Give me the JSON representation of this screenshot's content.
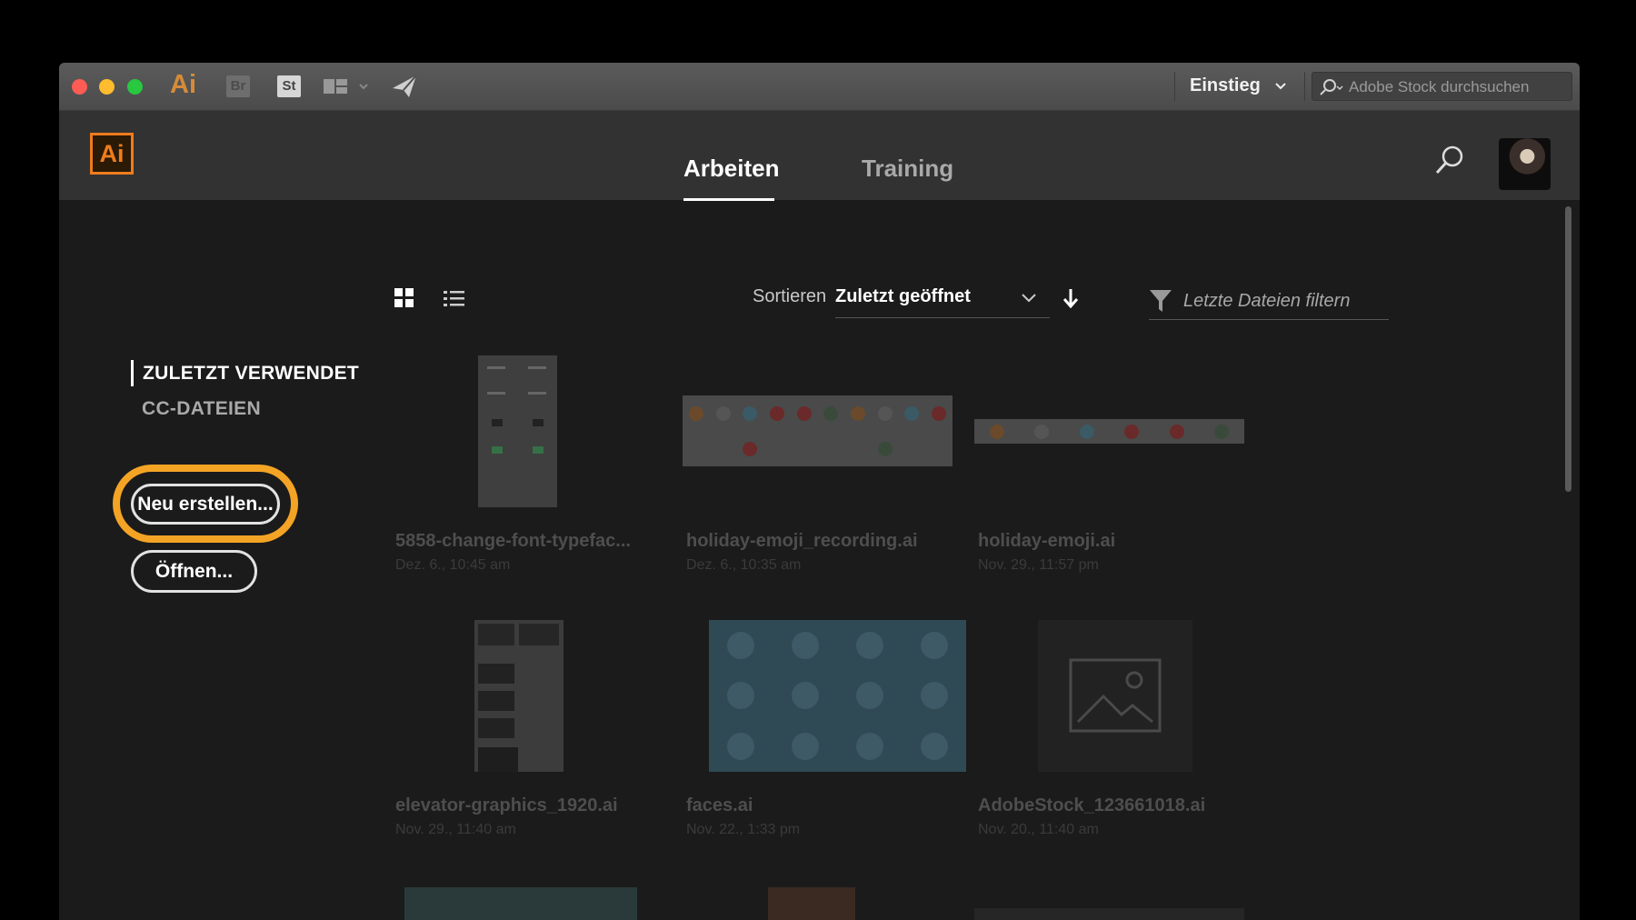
{
  "titlebar": {
    "app_glyph": "Ai",
    "bridge_label": "Br",
    "stock_label": "St",
    "workspace": "Einstieg",
    "stock_search_placeholder": "Adobe Stock durchsuchen"
  },
  "header": {
    "logo": "Ai",
    "tabs": [
      {
        "label": "Arbeiten",
        "active": true
      },
      {
        "label": "Training",
        "active": false
      }
    ]
  },
  "sidebar": {
    "nav": [
      {
        "label": "ZULETZT VERWENDET",
        "active": true
      },
      {
        "label": "CC-DATEIEN",
        "active": false
      }
    ],
    "new_button": "Neu erstellen...",
    "open_button": "Öffnen..."
  },
  "toolbar": {
    "sort_label": "Sortieren",
    "sort_value": "Zuletzt geöffnet",
    "filter_placeholder": "Letzte Dateien filtern"
  },
  "files": [
    {
      "name": "5858-change-font-typeface.ai",
      "display": "5858-change-font-typefac...",
      "date": "Dez. 6., 10:45 am"
    },
    {
      "name": "holiday-emoji_recording.ai",
      "display": "holiday-emoji_recording.ai",
      "date": "Dez. 6., 10:35 am"
    },
    {
      "name": "holiday-emoji.ai",
      "display": "holiday-emoji.ai",
      "date": "Nov. 29., 11:57 pm"
    },
    {
      "name": "elevator-graphics_1920.ai",
      "display": "elevator-graphics_1920.ai",
      "date": "Nov. 29., 11:40 am"
    },
    {
      "name": "faces.ai",
      "display": "faces.ai",
      "date": "Nov. 22., 1:33 pm"
    },
    {
      "name": "AdobeStock_123661018.ai",
      "display": "AdobeStock_123661018.ai",
      "date": "Nov. 20., 11:40 am"
    }
  ],
  "colors": {
    "accent_orange": "#f4a425",
    "ai_orange": "#ee7c1e",
    "window_bg": "#1b1b1b",
    "header_bg": "#323232",
    "titlebar_bg": "#4e4e4e"
  }
}
